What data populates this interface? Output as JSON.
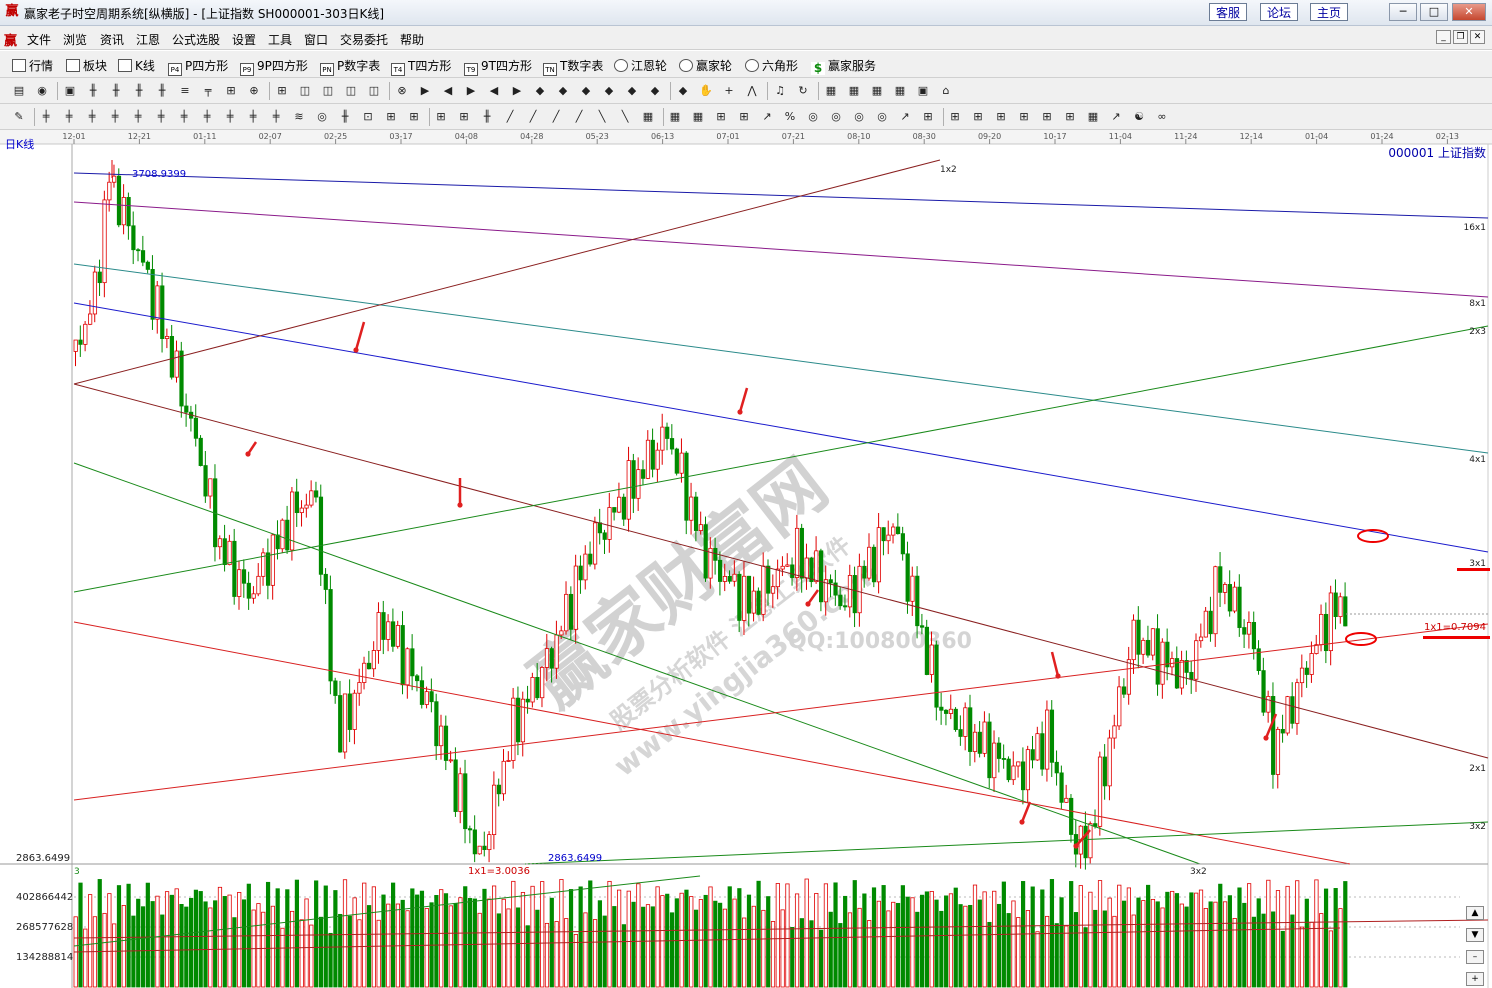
{
  "window": {
    "title": "赢家老子时空周期系统[纵横版] - [上证指数  SH000001-303日K线]",
    "links": [
      "客服",
      "论坛",
      "主页"
    ],
    "app_icon": "赢"
  },
  "menu": {
    "icon": "赢",
    "items": [
      "文件",
      "浏览",
      "资讯",
      "江恩",
      "公式选股",
      "设置",
      "工具",
      "窗口",
      "交易委托",
      "帮助"
    ]
  },
  "toolbar1": {
    "items": [
      {
        "icon": "grid-icon",
        "label": "行情"
      },
      {
        "icon": "blocks-icon",
        "label": "板块"
      },
      {
        "icon": "kline-icon",
        "label": "K线"
      },
      {
        "icon": "P4",
        "label": "P四方形"
      },
      {
        "icon": "P9",
        "label": "9P四方形"
      },
      {
        "icon": "PN",
        "label": "P数字表"
      },
      {
        "icon": "T4",
        "label": "T四方形"
      },
      {
        "icon": "T9",
        "label": "9T四方形"
      },
      {
        "icon": "TN",
        "label": "T数字表"
      },
      {
        "icon": "gann-wheel-icon",
        "label": "江恩轮"
      },
      {
        "icon": "winner-wheel-icon",
        "label": "赢家轮"
      },
      {
        "icon": "hexagon-icon",
        "label": "六角形"
      },
      {
        "icon": "dollar-icon",
        "label": "赢家服务"
      }
    ]
  },
  "chart_data": {
    "type": "candlestick",
    "period_label": "日K线",
    "symbol_label": "000001  上证指数",
    "x_ticks": [
      "12-01",
      "12-21",
      "01-11",
      "02-07",
      "02-25",
      "03-17",
      "04-08",
      "04-28",
      "05-23",
      "06-13",
      "07-01",
      "07-21",
      "08-10",
      "08-30",
      "09-20",
      "10-17",
      "11-04",
      "11-24",
      "12-14",
      "01-04",
      "01-24",
      "02-13"
    ],
    "price_range": [
      2863.6499,
      3708.9399
    ],
    "annotations": {
      "high": "3708.9399",
      "low": "2863.6499",
      "low_axis_label": "2863.6499",
      "pivot_label": "1x1=3.0036",
      "current_label": "1x1=0.7094",
      "bottom_left_tick": "3"
    },
    "gann_line_labels": [
      "1x2",
      "16x1",
      "8x1",
      "2x3",
      "4x1",
      "3x1",
      "2x1",
      "3x2",
      "3x2"
    ],
    "volume_axis_labels": [
      "402866442",
      "268577628",
      "134288814"
    ],
    "colors": {
      "up": "#e00000",
      "down": "#008a00",
      "background": "#ffffff"
    },
    "watermark": [
      "赢家财富网",
      "股票分析软件  江恩工具软件",
      "www.yingjia360.com",
      "QQ:100800360"
    ]
  }
}
